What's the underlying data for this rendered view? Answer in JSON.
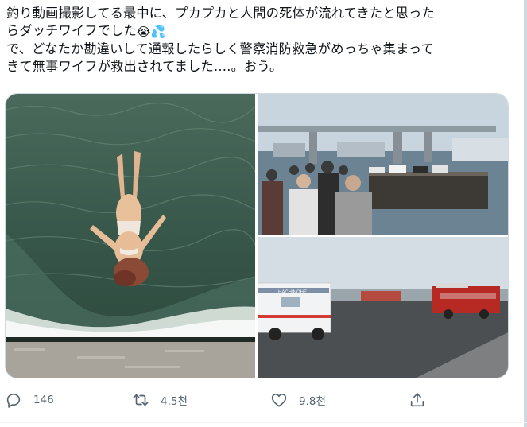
{
  "tweet": {
    "line1": "釣り動画撮影してる最中に、プカプカと人間の死体が流れてきたと思った",
    "line2_text": "らダッチワイフでした",
    "line2_emoji1": "😭",
    "line2_emoji2": "💦",
    "line3": "で、どなたか勘違いして通報したらしく警察消防救急がめっちゃ集まって",
    "line4": "きて無事ワイフが救出されてました….。おう。"
  },
  "media": {
    "photo1": "doll-floating-in-water",
    "photo2": "crowd-on-pier",
    "photo3": "ambulance-and-fire-trucks",
    "ambulance_label": "HACHINOHE"
  },
  "actions": {
    "reply_count": "146",
    "retweet_count": "4.5천",
    "like_count": "9.8천",
    "icons": [
      "reply-icon",
      "retweet-icon",
      "like-icon",
      "share-icon"
    ],
    "icon_color": "#536471"
  }
}
